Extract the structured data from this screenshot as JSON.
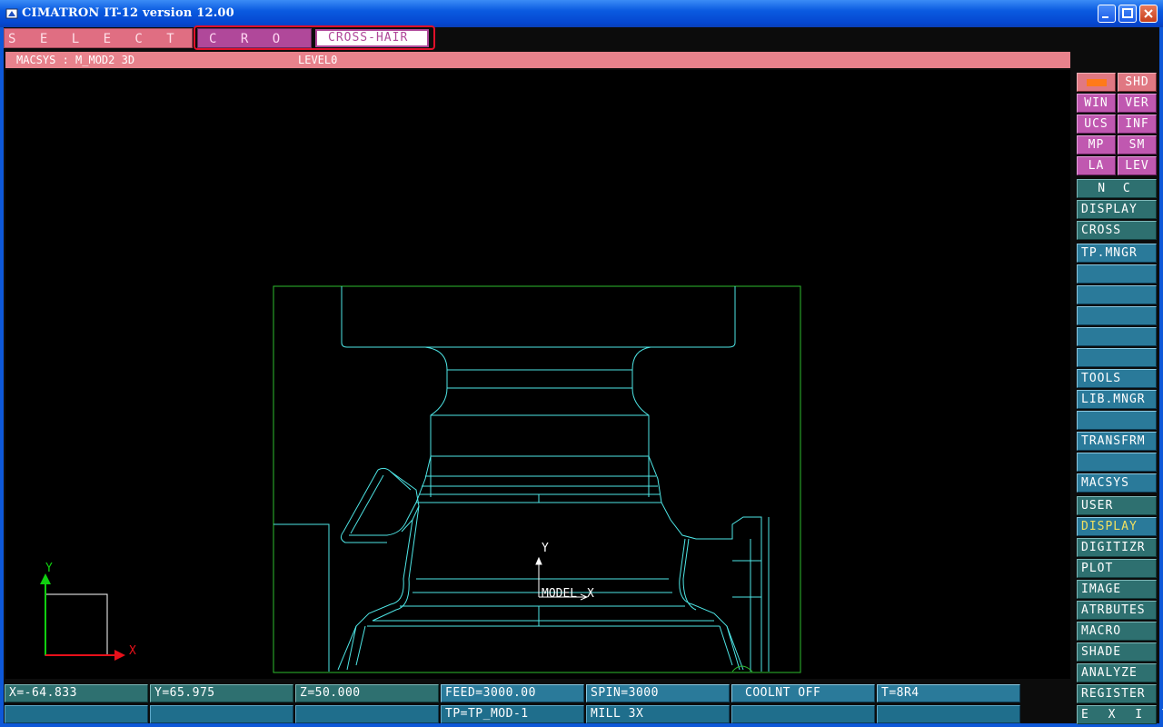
{
  "window": {
    "title": "CIMATRON IT-12 version 12.00"
  },
  "prompt": {
    "select_label": "S E L E C T",
    "cross_label": "C R O S S",
    "crosshair_label": "CROSS-HAIR"
  },
  "header": {
    "macsys": "MACSYS : M_MOD2 3D",
    "level": "LEVEL0"
  },
  "viewport": {
    "axis_labels": {
      "x": "X",
      "y": "Y"
    },
    "model_label": "MODEL",
    "model_x": "X",
    "model_y": "Y",
    "colors": {
      "geometry": "#4ee6e6",
      "stock_box": "#2ebc2e",
      "axis_x": "#e8101a",
      "axis_y": "#10d010"
    }
  },
  "right_panel": {
    "display_group": [
      {
        "label": "",
        "icon": "color-swatch-icon"
      },
      {
        "label": "SHD"
      },
      {
        "label": "WIN"
      },
      {
        "label": "VER"
      },
      {
        "label": "UCS"
      },
      {
        "label": "INF"
      },
      {
        "label": "MP"
      },
      {
        "label": "SM"
      },
      {
        "label": "LA"
      },
      {
        "label": "LEV"
      }
    ],
    "nc": "N C",
    "nc_display": "DISPLAY",
    "nc_cross": "CROSS",
    "tp_mngr": "TP.MNGR",
    "tools": "TOOLS",
    "lib_mngr": "LIB.MNGR",
    "transfrm": "TRANSFRM",
    "macsys": "MACSYS",
    "user": "USER",
    "display": "DISPLAY",
    "digitizr": "DIGITIZR",
    "plot": "PLOT",
    "image": "IMAGE",
    "atrbutes": "ATRBUTES",
    "macro": "MACRO",
    "shade": "SHADE",
    "analyze": "ANALYZE",
    "register": "REGISTER",
    "exit": "E X I T"
  },
  "status": {
    "x": "X=-64.833",
    "y": "Y=65.975",
    "z": "Z=50.000",
    "feed": "FEED=3000.00",
    "spin": "SPIN=3000",
    "coolnt": "COOLNT OFF",
    "tool": "T=8R4",
    "tp": "TP=TP_MOD-1",
    "mill": "MILL 3X"
  }
}
